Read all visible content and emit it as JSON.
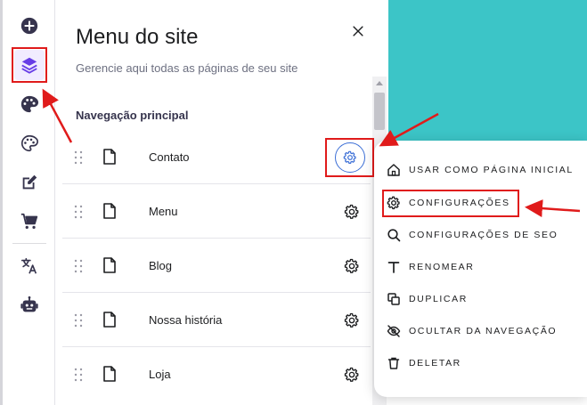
{
  "panel": {
    "title": "Menu do site",
    "subtitle": "Gerencie aqui todas as páginas de seu site",
    "section_title": "Navegação principal",
    "pages": [
      {
        "label": "Contato"
      },
      {
        "label": "Menu"
      },
      {
        "label": "Blog"
      },
      {
        "label": "Nossa história"
      },
      {
        "label": "Loja"
      }
    ]
  },
  "rail": {
    "icons": [
      "add-icon",
      "layers-icon",
      "palette-icon",
      "palette-outline-icon",
      "edit-icon",
      "cart-icon",
      "translate-icon",
      "robot-icon"
    ]
  },
  "context_menu": {
    "items": [
      {
        "label": "USAR COMO PÁGINA INICIAL",
        "icon": "home-icon"
      },
      {
        "label": "CONFIGURAÇÕES",
        "icon": "gear-icon"
      },
      {
        "label": "CONFIGURAÇÕES DE SEO",
        "icon": "search-icon"
      },
      {
        "label": "RENOMEAR",
        "icon": "text-icon"
      },
      {
        "label": "DUPLICAR",
        "icon": "duplicate-icon"
      },
      {
        "label": "OCULTAR DA NAVEGAÇÃO",
        "icon": "eye-off-icon"
      },
      {
        "label": "DELETAR",
        "icon": "trash-icon"
      }
    ]
  },
  "colors": {
    "accent": "#673de6",
    "highlight": "#e01b1b",
    "preview": "#3cc5c7",
    "gear_ring": "#3c6fd6"
  }
}
